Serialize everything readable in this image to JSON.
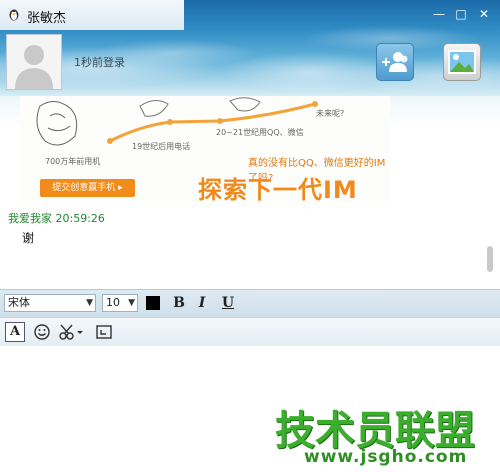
{
  "window": {
    "title": "张敏杰",
    "minimize_glyph": "—",
    "maximize_glyph": "□",
    "close_glyph": "✕"
  },
  "contact": {
    "status_text": "1秒前登录"
  },
  "ad": {
    "captions": [
      "700万年前用机",
      "19世纪后用电话",
      "20~21世纪用QQ、微信",
      "未来呢?"
    ],
    "tagline": "真的没有比QQ、微信更好的IM了吗?",
    "headline": "探索下一代IM",
    "button_label": "提交创意赢手机 ▸"
  },
  "message": {
    "sender": "我爱我家",
    "time": "20:59:26",
    "body": "谢"
  },
  "format_toolbar": {
    "font_name": "宋体",
    "font_size": "10",
    "bold_label": "B",
    "italic_label": "I",
    "underline_label": "U",
    "color": "#000000"
  },
  "input_toolbar": {
    "font_tool_label": "A"
  },
  "watermark": {
    "text": "技术员联盟",
    "url": "www.jsgho.com"
  },
  "colors": {
    "sender": "#1e8a2e",
    "ad_orange": "#f08a1c",
    "watermark_green": "#3cae2e"
  }
}
